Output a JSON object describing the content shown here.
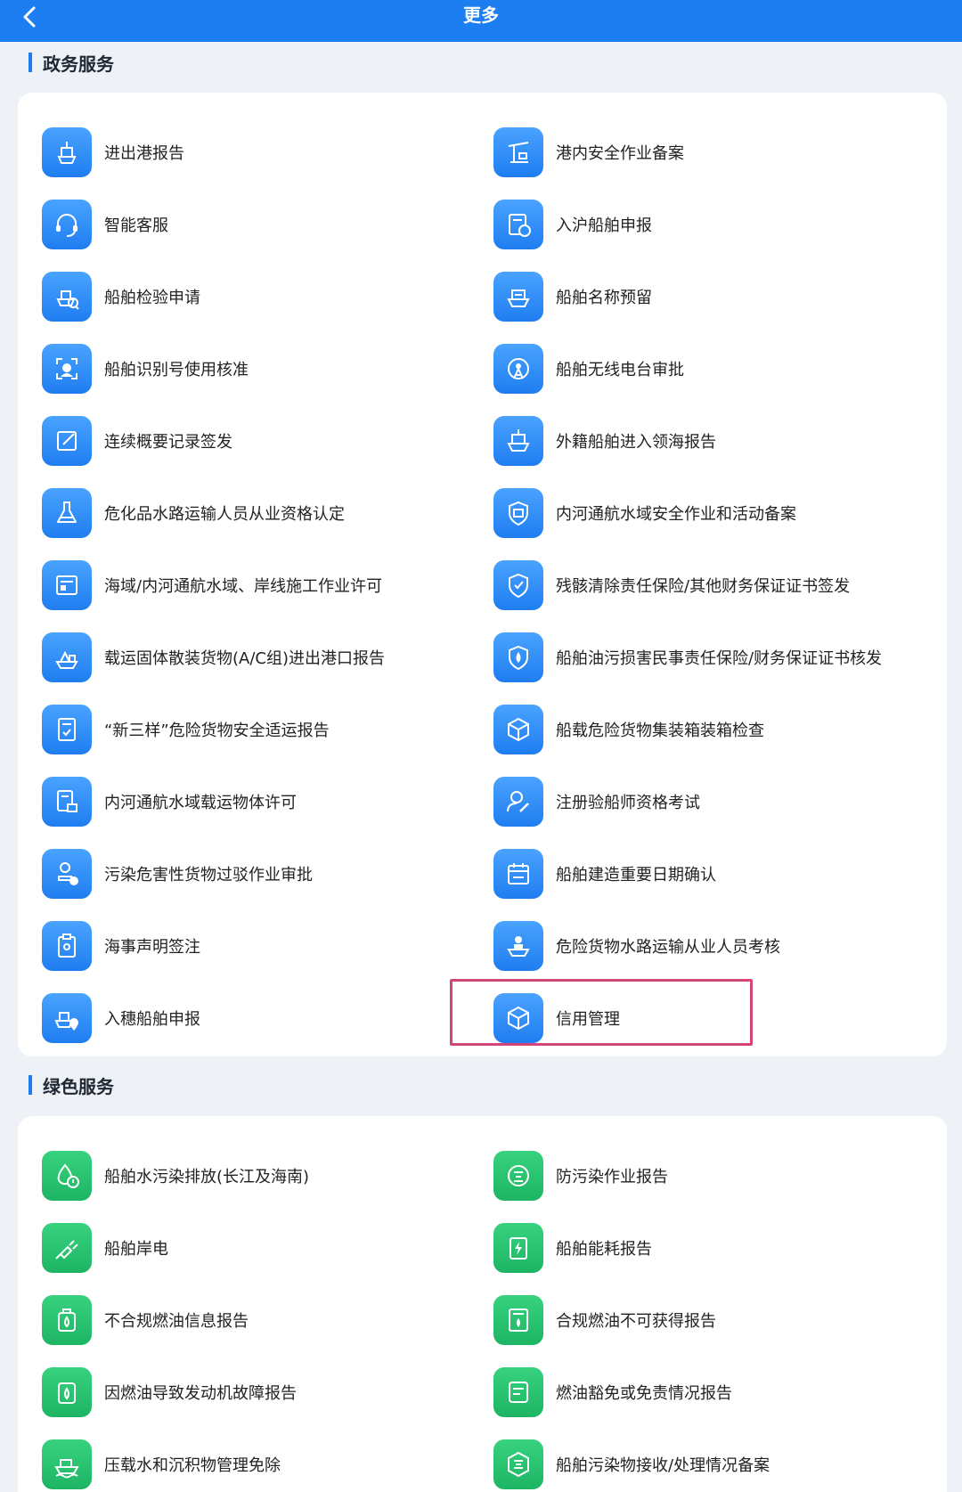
{
  "header": {
    "title": "更多",
    "back_icon": "chevron-left-icon",
    "bar_color": "#1c7ef0"
  },
  "sections": [
    {
      "title": "政务服务",
      "icon_color": "blue",
      "items": [
        {
          "label": "进出港报告",
          "icon": "ship-icon"
        },
        {
          "label": "港内安全作业备案",
          "icon": "crane-icon"
        },
        {
          "label": "智能客服",
          "icon": "headset-icon"
        },
        {
          "label": "入沪船舶申报",
          "icon": "document-stamp-icon"
        },
        {
          "label": "船舶检验申请",
          "icon": "ship-search-icon"
        },
        {
          "label": "船舶名称预留",
          "icon": "ship-name-icon"
        },
        {
          "label": "船舶识别号使用核准",
          "icon": "scan-id-icon"
        },
        {
          "label": "船舶无线电台审批",
          "icon": "radio-tower-icon"
        },
        {
          "label": "连续概要记录签发",
          "icon": "edit-icon"
        },
        {
          "label": "外籍船舶进入领海报告",
          "icon": "foreign-ship-icon"
        },
        {
          "label": "危化品水路运输人员从业资格认定",
          "icon": "flask-icon"
        },
        {
          "label": "内河通航水域安全作业和活动备案",
          "icon": "shield-record-icon"
        },
        {
          "label": "海域/内河通航水域、岸线施工作业许可",
          "icon": "construction-permit-icon"
        },
        {
          "label": "残骸清除责任保险/其他财务保证证书签发",
          "icon": "insurance-shield-icon"
        },
        {
          "label": "载运固体散装货物(A/C组)进出港口报告",
          "icon": "bulk-cargo-icon"
        },
        {
          "label": "船舶油污损害民事责任保险/财务保证证书核发",
          "icon": "oil-insurance-icon"
        },
        {
          "label": "“新三样”危险货物安全适运报告",
          "icon": "safety-report-icon"
        },
        {
          "label": "船载危险货物集装箱装箱检查",
          "icon": "container-inspect-icon"
        },
        {
          "label": "内河通航水域载运物体许可",
          "icon": "cargo-permit-icon"
        },
        {
          "label": "注册验船师资格考试",
          "icon": "user-edit-icon"
        },
        {
          "label": "污染危害性货物过驳作业审批",
          "icon": "stamp-check-icon"
        },
        {
          "label": "船舶建造重要日期确认",
          "icon": "calendar-icon"
        },
        {
          "label": "海事声明签注",
          "icon": "clipboard-anchor-icon"
        },
        {
          "label": "危险货物水路运输从业人员考核",
          "icon": "crew-ship-icon"
        },
        {
          "label": "入穗船舶申报",
          "icon": "ship-location-icon"
        },
        {
          "label": "信用管理",
          "icon": "cube-icon"
        }
      ]
    },
    {
      "title": "绿色服务",
      "icon_color": "green",
      "items": [
        {
          "label": "船舶水污染排放(长江及海南)",
          "icon": "water-pollution-icon"
        },
        {
          "label": "防污染作业报告",
          "icon": "pollution-circle-icon"
        },
        {
          "label": "船舶岸电",
          "icon": "plug-icon"
        },
        {
          "label": "船舶能耗报告",
          "icon": "energy-report-icon"
        },
        {
          "label": "不合规燃油信息报告",
          "icon": "fuel-can-icon"
        },
        {
          "label": "合规燃油不可获得报告",
          "icon": "fuel-doc-icon"
        },
        {
          "label": "因燃油导致发动机故障报告",
          "icon": "fuel-fault-icon"
        },
        {
          "label": "燃油豁免或免责情况报告",
          "icon": "notes-icon"
        },
        {
          "label": "压载水和沉积物管理免除",
          "icon": "ballast-ship-icon"
        },
        {
          "label": "船舶污染物接收/处理情况备案",
          "icon": "pollution-hex-icon"
        }
      ]
    }
  ],
  "highlighted_item": "信用管理",
  "highlight_color": "#d2467a"
}
